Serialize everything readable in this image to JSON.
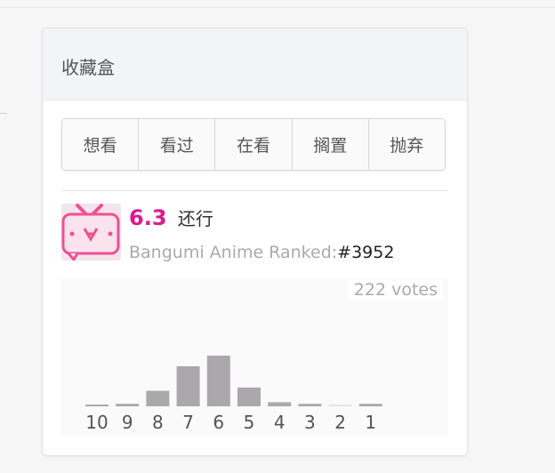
{
  "collection_box": {
    "title": "收藏盒",
    "actions": [
      "想看",
      "看过",
      "在看",
      "搁置",
      "抛弃"
    ]
  },
  "rating": {
    "score": "6.3",
    "label": "还行",
    "rank_prefix": "Bangumi Anime Ranked:",
    "rank": "#3952",
    "votes_text": "222 votes",
    "accent_color": "#e0168c"
  },
  "chart_data": {
    "type": "bar",
    "categories": [
      "10",
      "9",
      "8",
      "7",
      "6",
      "5",
      "4",
      "3",
      "2",
      "1"
    ],
    "values": [
      2,
      3,
      19,
      49,
      62,
      23,
      5,
      3,
      1,
      3
    ],
    "ylim": [
      0,
      62
    ],
    "bar_color": "#aaa8ab"
  }
}
